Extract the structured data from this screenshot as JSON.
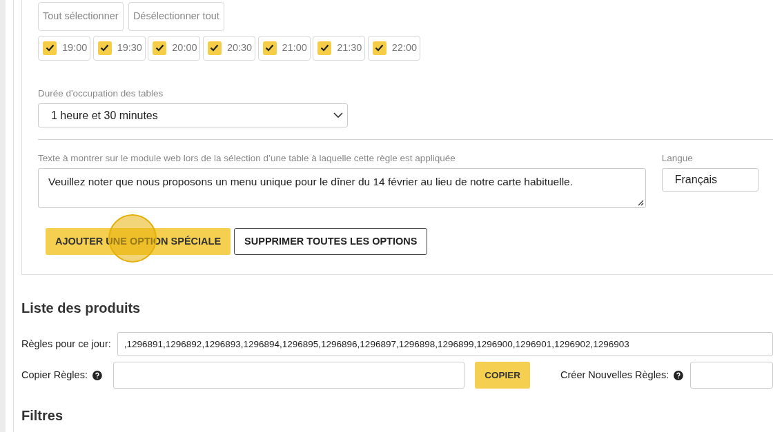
{
  "selection_buttons": [
    "Tout sélectionner",
    "Désélectionner tout"
  ],
  "time_slots": [
    {
      "label": "19:00",
      "checked": true
    },
    {
      "label": "19:30",
      "checked": true
    },
    {
      "label": "20:00",
      "checked": true
    },
    {
      "label": "20:30",
      "checked": true
    },
    {
      "label": "21:00",
      "checked": true
    },
    {
      "label": "21:30",
      "checked": true
    },
    {
      "label": "22:00",
      "checked": true
    }
  ],
  "duration": {
    "label": "Durée d'occupation des tables",
    "value": "1 heure et 30 minutes"
  },
  "web_text": {
    "label": "Texte à montrer sur le module web lors de la sélection d’une table à laquelle cette règle est appliquée",
    "value": "Veuillez noter que nous proposons un menu unique pour le dîner du 14 février au lieu de notre carte habituelle."
  },
  "language": {
    "label": "Langue",
    "value": "Français"
  },
  "option_buttons": [
    "AJOUTER UNE OPTION SPÉCIALE",
    "SUPPRIMER TOUTES LES OPTIONS"
  ],
  "click_indicator": true,
  "products": {
    "title": "Liste des produits",
    "rules_label": "Règles pour ce jour:",
    "rules_value": ",1296891,1296892,1296893,1296894,1296895,1296896,1296897,1296898,1296899,1296900,1296901,1296902,1296903",
    "copy_label": "Copier Règles:",
    "copy_button": "COPIER",
    "create_label": "Créer Nouvelles Règles:"
  },
  "filters": {
    "title": "Filtres"
  }
}
